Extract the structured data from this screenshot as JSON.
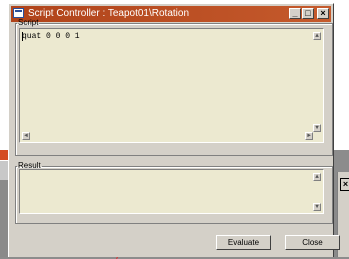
{
  "window": {
    "title": "Script Controller : Teapot01\\Rotation",
    "buttons": {
      "minimize": "_",
      "maximize": "□",
      "close": "×"
    }
  },
  "script_group": {
    "legend": "Script",
    "text": "quat 0 0 0 1"
  },
  "result_group": {
    "legend": "Result",
    "text": ""
  },
  "actions": {
    "evaluate_label": "Evaluate",
    "close_label": "Close"
  },
  "background": {
    "close_glyph": "×"
  },
  "colors": {
    "titlebar": "#b0431a",
    "dialog_face": "#d4d0c8",
    "text_area": "#ece9d0",
    "accent_line": "#e03030"
  }
}
